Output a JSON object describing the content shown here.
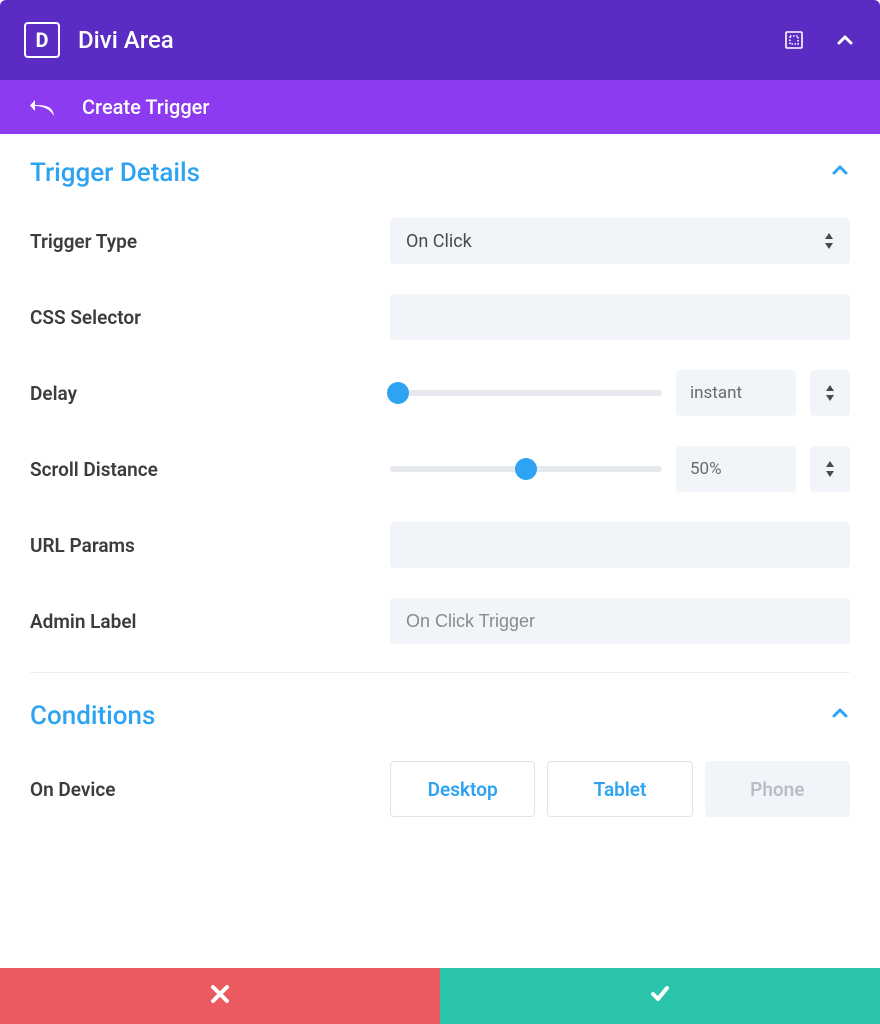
{
  "header": {
    "logo_letter": "D",
    "title": "Divi Area"
  },
  "subheader": {
    "title": "Create Trigger"
  },
  "section_trigger": {
    "title": "Trigger Details",
    "fields": {
      "trigger_type": {
        "label": "Trigger Type",
        "value": "On Click"
      },
      "css_selector": {
        "label": "CSS Selector",
        "value": ""
      },
      "delay": {
        "label": "Delay",
        "value": "instant",
        "position_pct": 3
      },
      "scroll_distance": {
        "label": "Scroll Distance",
        "value": "50%",
        "position_pct": 50
      },
      "url_params": {
        "label": "URL Params",
        "value": ""
      },
      "admin_label": {
        "label": "Admin Label",
        "placeholder": "On Click Trigger",
        "value": ""
      }
    }
  },
  "section_conditions": {
    "title": "Conditions",
    "on_device": {
      "label": "On Device",
      "options": [
        {
          "label": "Desktop",
          "state": "active"
        },
        {
          "label": "Tablet",
          "state": "active"
        },
        {
          "label": "Phone",
          "state": "disabled"
        }
      ]
    }
  }
}
